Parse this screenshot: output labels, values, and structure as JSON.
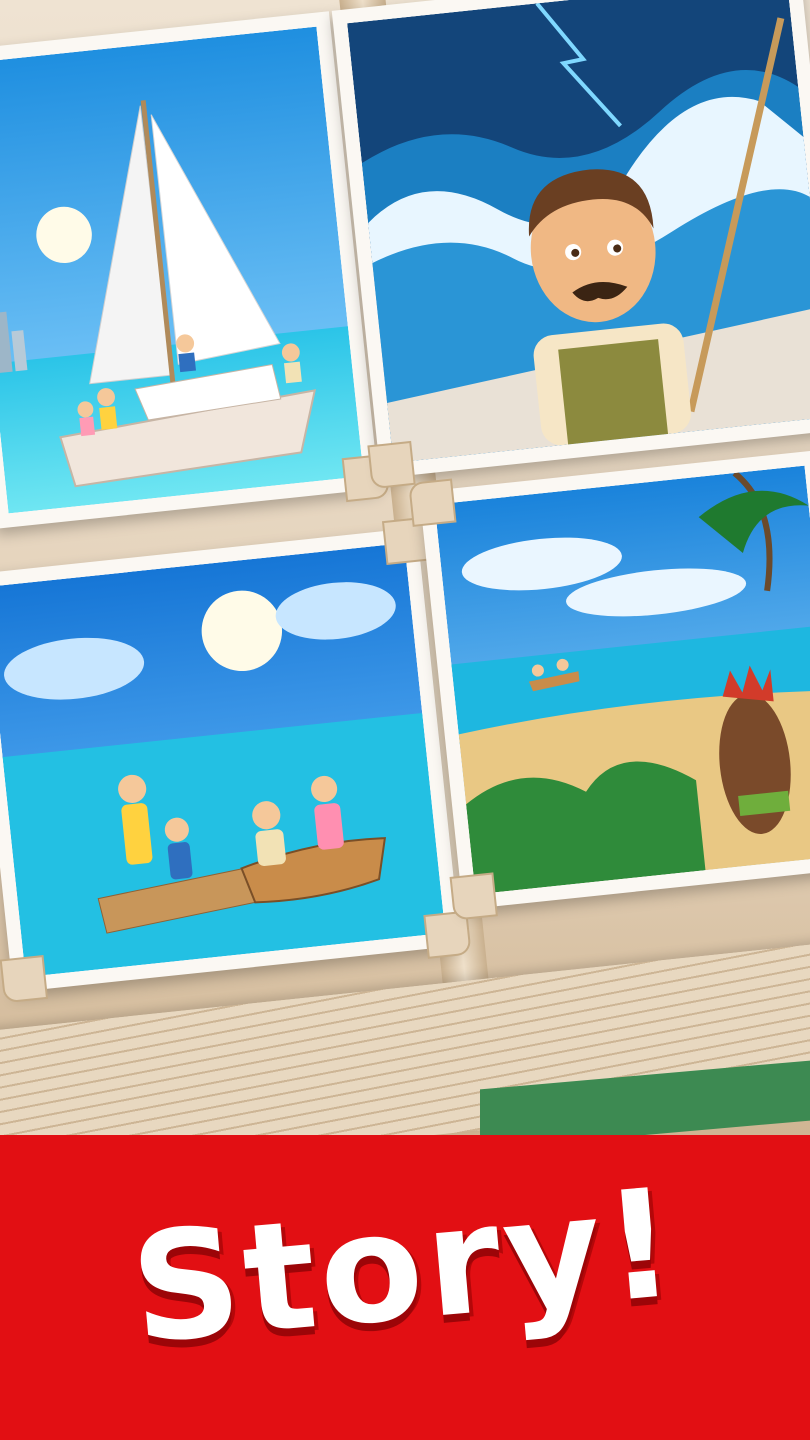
{
  "banner": {
    "title": "Story!",
    "background": "#e20f13",
    "text_color": "#ffffff"
  },
  "photos": [
    {
      "scene": "sailboat-family-icon"
    },
    {
      "scene": "storm-wave-sailor-icon"
    },
    {
      "scene": "raft-and-rowboat-icon"
    },
    {
      "scene": "island-beach-native-icon"
    }
  ]
}
